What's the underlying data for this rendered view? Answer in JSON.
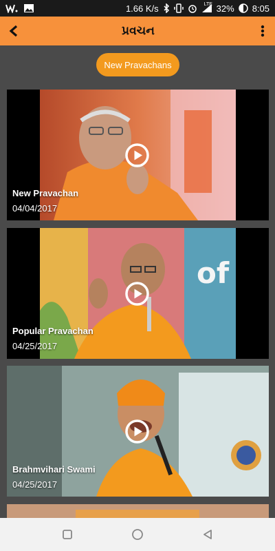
{
  "status_bar": {
    "network_speed": "1.66 K/s",
    "battery_percent": "32%",
    "time": "8:05",
    "network_type": "LTE",
    "icons": [
      "wish-app-icon",
      "image-icon",
      "bluetooth-icon",
      "vibrate-icon",
      "alarm-icon",
      "signal-icon",
      "battery-icon"
    ]
  },
  "app_bar": {
    "title": "પ્રવચન",
    "back_icon": "back-arrow-icon",
    "menu_icon": "more-vert-icon"
  },
  "filter_button": {
    "label": "New Pravachans"
  },
  "cards": [
    {
      "title": "New Pravachan",
      "date": "04/04/2017"
    },
    {
      "title": "Popular Pravachan",
      "date": "04/25/2017"
    },
    {
      "title": "Brahmvihari Swami",
      "date": "04/25/2017"
    }
  ],
  "colors": {
    "app_bar": "#f7913b",
    "pill": "#f39a1e",
    "background": "#4a4a4a"
  }
}
